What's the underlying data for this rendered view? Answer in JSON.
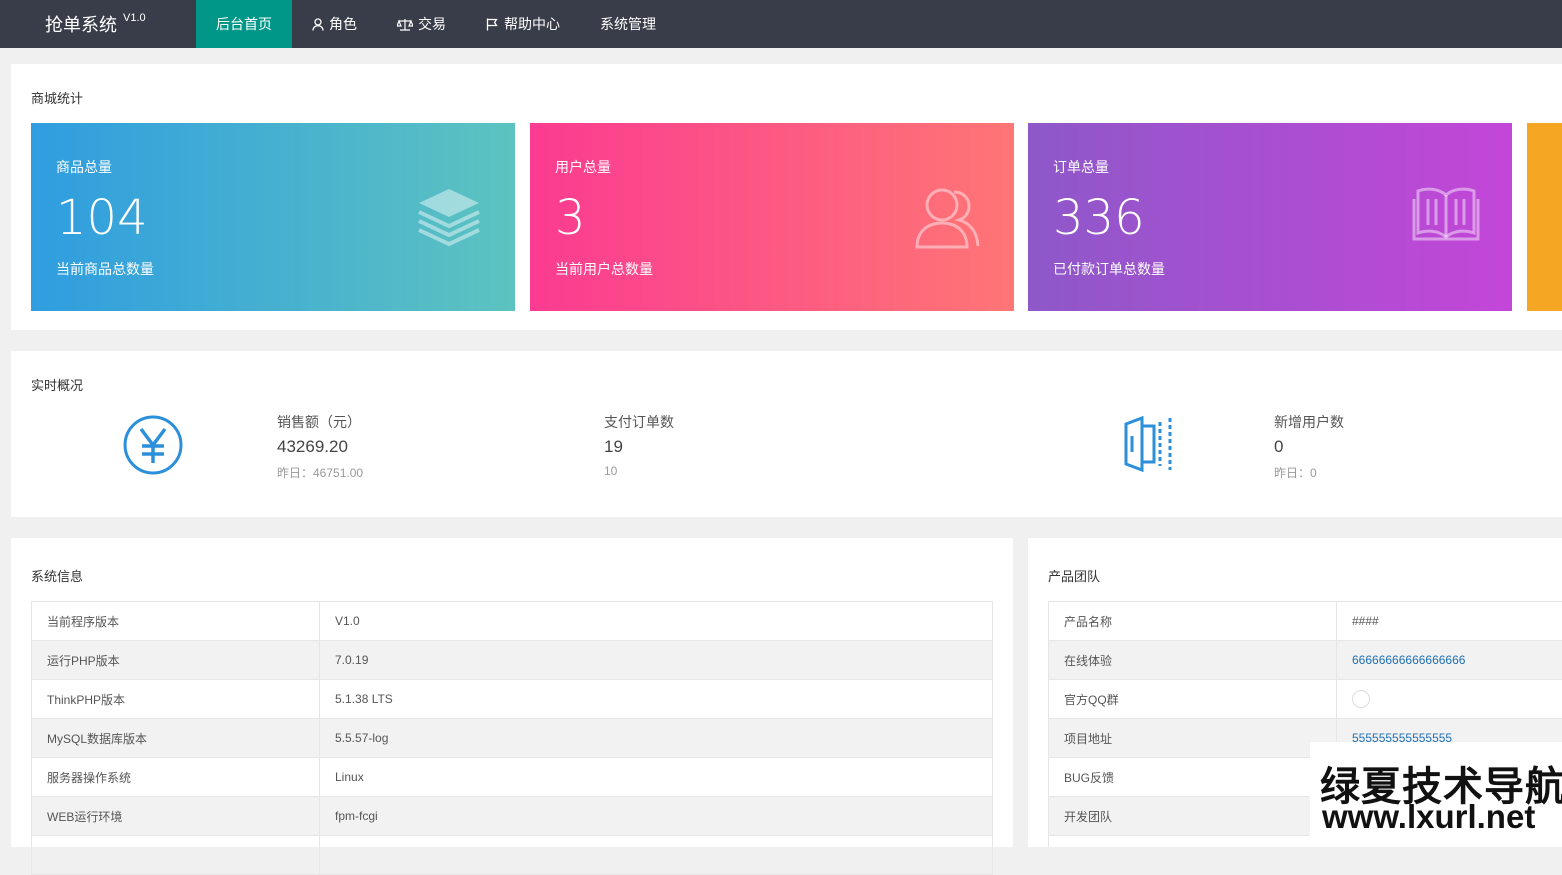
{
  "app": {
    "title": "抢单系统",
    "version": "V1.0"
  },
  "nav": [
    {
      "label": "后台首页",
      "icon": "",
      "active": true
    },
    {
      "label": "角色",
      "icon": "user-icon"
    },
    {
      "label": "交易",
      "icon": "scale-icon"
    },
    {
      "label": "帮助中心",
      "icon": "flag-icon"
    },
    {
      "label": "系统管理",
      "icon": ""
    }
  ],
  "shop_stats": {
    "title": "商城统计",
    "cards": [
      {
        "label": "商品总量",
        "value": "104",
        "sub": "当前商品总数量",
        "icon": "layers-icon",
        "gradient": [
          "#2f9de0",
          "#5dc3c0"
        ]
      },
      {
        "label": "用户总量",
        "value": "3",
        "sub": "当前用户总数量",
        "icon": "users-icon",
        "gradient": [
          "#fb3b91",
          "#fe7675"
        ]
      },
      {
        "label": "订单总量",
        "value": "336",
        "sub": "已付款订单总数量",
        "icon": "book-icon",
        "gradient": [
          "#8e58c9",
          "#c346d8"
        ]
      }
    ],
    "partial_card_color": "#f5a623"
  },
  "realtime": {
    "title": "实时概况",
    "sales": {
      "label": "销售额（元）",
      "value": "43269.20",
      "yesterday": "昨日：46751.00",
      "icon": "yen-icon"
    },
    "orders": {
      "label": "支付订单数",
      "value": "19",
      "yesterday": "10"
    },
    "new_users": {
      "label": "新增用户数",
      "value": "0",
      "yesterday": "昨日：0",
      "icon": "door-icon"
    }
  },
  "system_info": {
    "title": "系统信息",
    "rows": [
      {
        "key": "当前程序版本",
        "value": "V1.0"
      },
      {
        "key": "运行PHP版本",
        "value": "7.0.19"
      },
      {
        "key": "ThinkPHP版本",
        "value": "5.1.38 LTS"
      },
      {
        "key": "MySQL数据库版本",
        "value": "5.5.57-log"
      },
      {
        "key": "服务器操作系统",
        "value": "Linux"
      },
      {
        "key": "WEB运行环境",
        "value": "fpm-fcgi"
      }
    ]
  },
  "product_team": {
    "title": "产品团队",
    "rows": [
      {
        "key": "产品名称",
        "value": "####"
      },
      {
        "key": "在线体验",
        "value": "66666666666666666"
      },
      {
        "key": "官方QQ群",
        "value": ""
      },
      {
        "key": "项目地址",
        "value": "555555555555555"
      },
      {
        "key": "BUG反馈",
        "value": ""
      },
      {
        "key": "开发团队",
        "value": ""
      }
    ]
  },
  "watermark": {
    "line1": "绿夏技术导航",
    "line2": "www.lxurl.net"
  },
  "colors": {
    "topbar": "#393d49",
    "active_nav": "#009688",
    "link": "#1e6fb3",
    "icon_blue": "#2b8fd9"
  }
}
